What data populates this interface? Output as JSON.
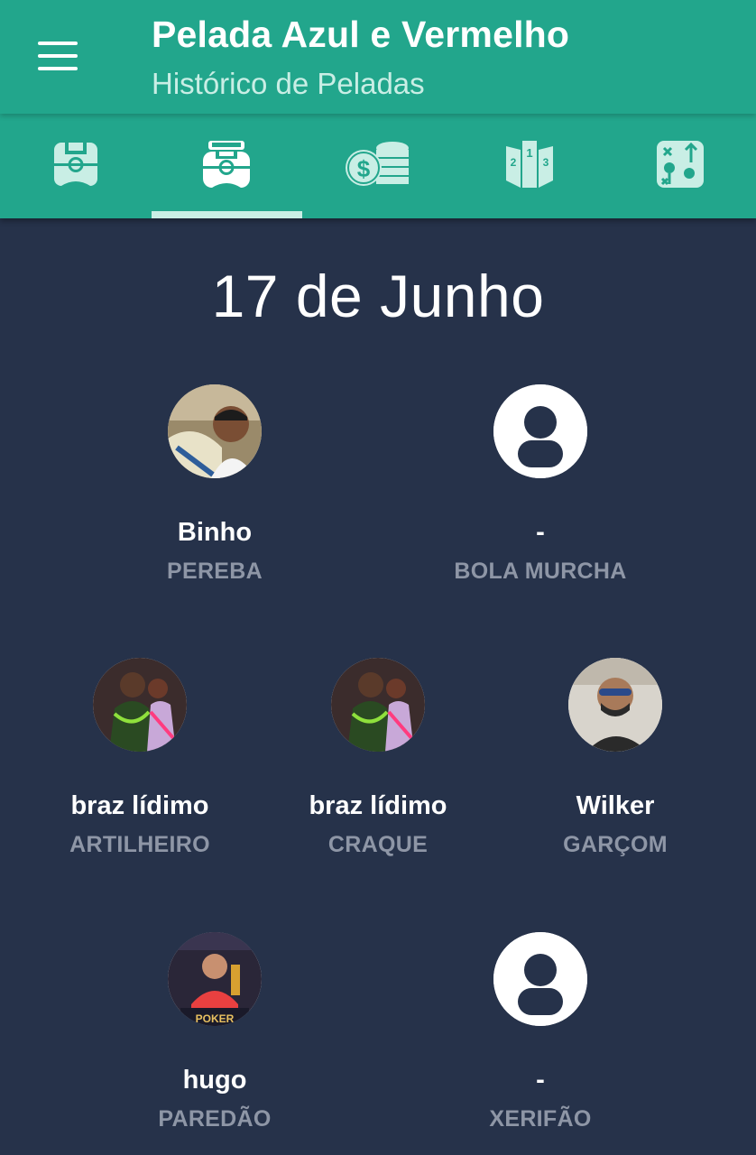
{
  "header": {
    "title": "Pelada Azul e Vermelho",
    "subtitle": "Histórico de Peladas"
  },
  "tabs": [
    {
      "icon": "field-icon",
      "active": false
    },
    {
      "icon": "history-field-icon",
      "active": true
    },
    {
      "icon": "money-coins-icon",
      "active": false
    },
    {
      "icon": "ranking-podium-icon",
      "active": false
    },
    {
      "icon": "tactics-board-icon",
      "active": false
    }
  ],
  "date": "17 de Junho",
  "awards": [
    {
      "name": "Binho",
      "role": "PEREBA",
      "avatar": "photo"
    },
    {
      "name": "-",
      "role": "BOLA MURCHA",
      "avatar": "placeholder"
    },
    {
      "name": "braz lídimo",
      "role": "ARTILHEIRO",
      "avatar": "photo"
    },
    {
      "name": "braz lídimo",
      "role": "CRAQUE",
      "avatar": "photo"
    },
    {
      "name": "Wilker",
      "role": "GARÇOM",
      "avatar": "photo"
    },
    {
      "name": "hugo",
      "role": "PAREDÃO",
      "avatar": "photo"
    },
    {
      "name": "-",
      "role": "XERIFÃO",
      "avatar": "placeholder"
    }
  ],
  "colors": {
    "primary": "#22a68c",
    "tab_icon": "#c9eee5",
    "background": "#26324a",
    "secondary_text": "#8e96a6"
  }
}
